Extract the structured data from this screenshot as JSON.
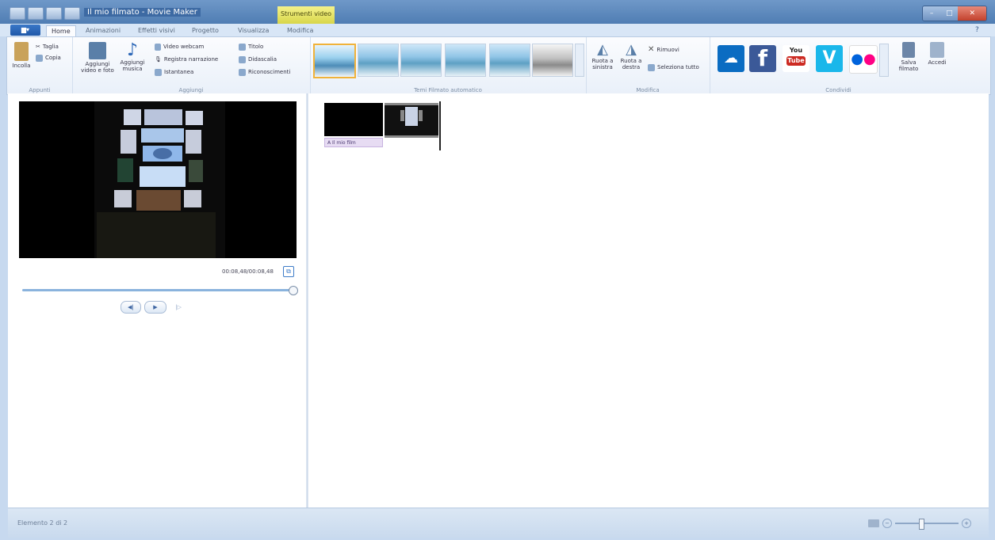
{
  "window": {
    "title": "Il mio filmato - Movie Maker",
    "context_tab": "Strumenti video",
    "controls": {
      "minimize": "–",
      "maximize": "□",
      "close": "✕"
    },
    "help": "?"
  },
  "tabs": {
    "file": "▆▾",
    "items": [
      {
        "label": "Home",
        "active": true
      },
      {
        "label": "Animazioni"
      },
      {
        "label": "Effetti visivi"
      },
      {
        "label": "Progetto"
      },
      {
        "label": "Visualizza"
      },
      {
        "label": "Modifica"
      }
    ]
  },
  "ribbon": {
    "appunti": {
      "label": "Appunti",
      "incolla": "Incolla",
      "taglia": "Taglia",
      "copia": "Copia"
    },
    "aggiungi": {
      "label": "Aggiungi",
      "video_foto": "Aggiungi video e foto",
      "musica": "Aggiungi musica",
      "webcam": "Video webcam",
      "narrazione": "Registra narrazione",
      "istantanea": "Istantanea",
      "titolo": "Titolo",
      "didascalia": "Didascalia",
      "riconoscimenti": "Riconoscimenti"
    },
    "temi": {
      "label": "Temi Filmato automatico"
    },
    "modifica": {
      "label": "Modifica",
      "ruota_sinistra": "Ruota a sinistra",
      "ruota_destra": "Ruota a destra",
      "rimuovi": "Rimuovi",
      "seleziona_tutto": "Seleziona tutto"
    },
    "condividi": {
      "label": "Condividi",
      "salva_filmato": "Salva filmato",
      "accedi": "Accedi",
      "youtube_top": "You",
      "youtube_bottom": "Tube",
      "facebook": "f",
      "vimeo": "V",
      "flickr": "••"
    }
  },
  "preview": {
    "timecode": "00:08,48/00:08,48",
    "split_icon": "⧉",
    "controls": {
      "prev": "◀|",
      "play": "▶",
      "next": "|▷"
    },
    "seek_fraction": 1.0
  },
  "storyboard": {
    "clip_title": "Il mio film"
  },
  "status": {
    "text": "Elemento 2 di 2",
    "zoom_out": "−",
    "zoom_in": "+"
  },
  "colors": {
    "accent": "#1f58a8",
    "youtube": "#cc2a22",
    "facebook": "#3b5998",
    "vimeo": "#1ab7ea",
    "onedrive": "#0a6cc2",
    "flickr": "#ffffff"
  }
}
